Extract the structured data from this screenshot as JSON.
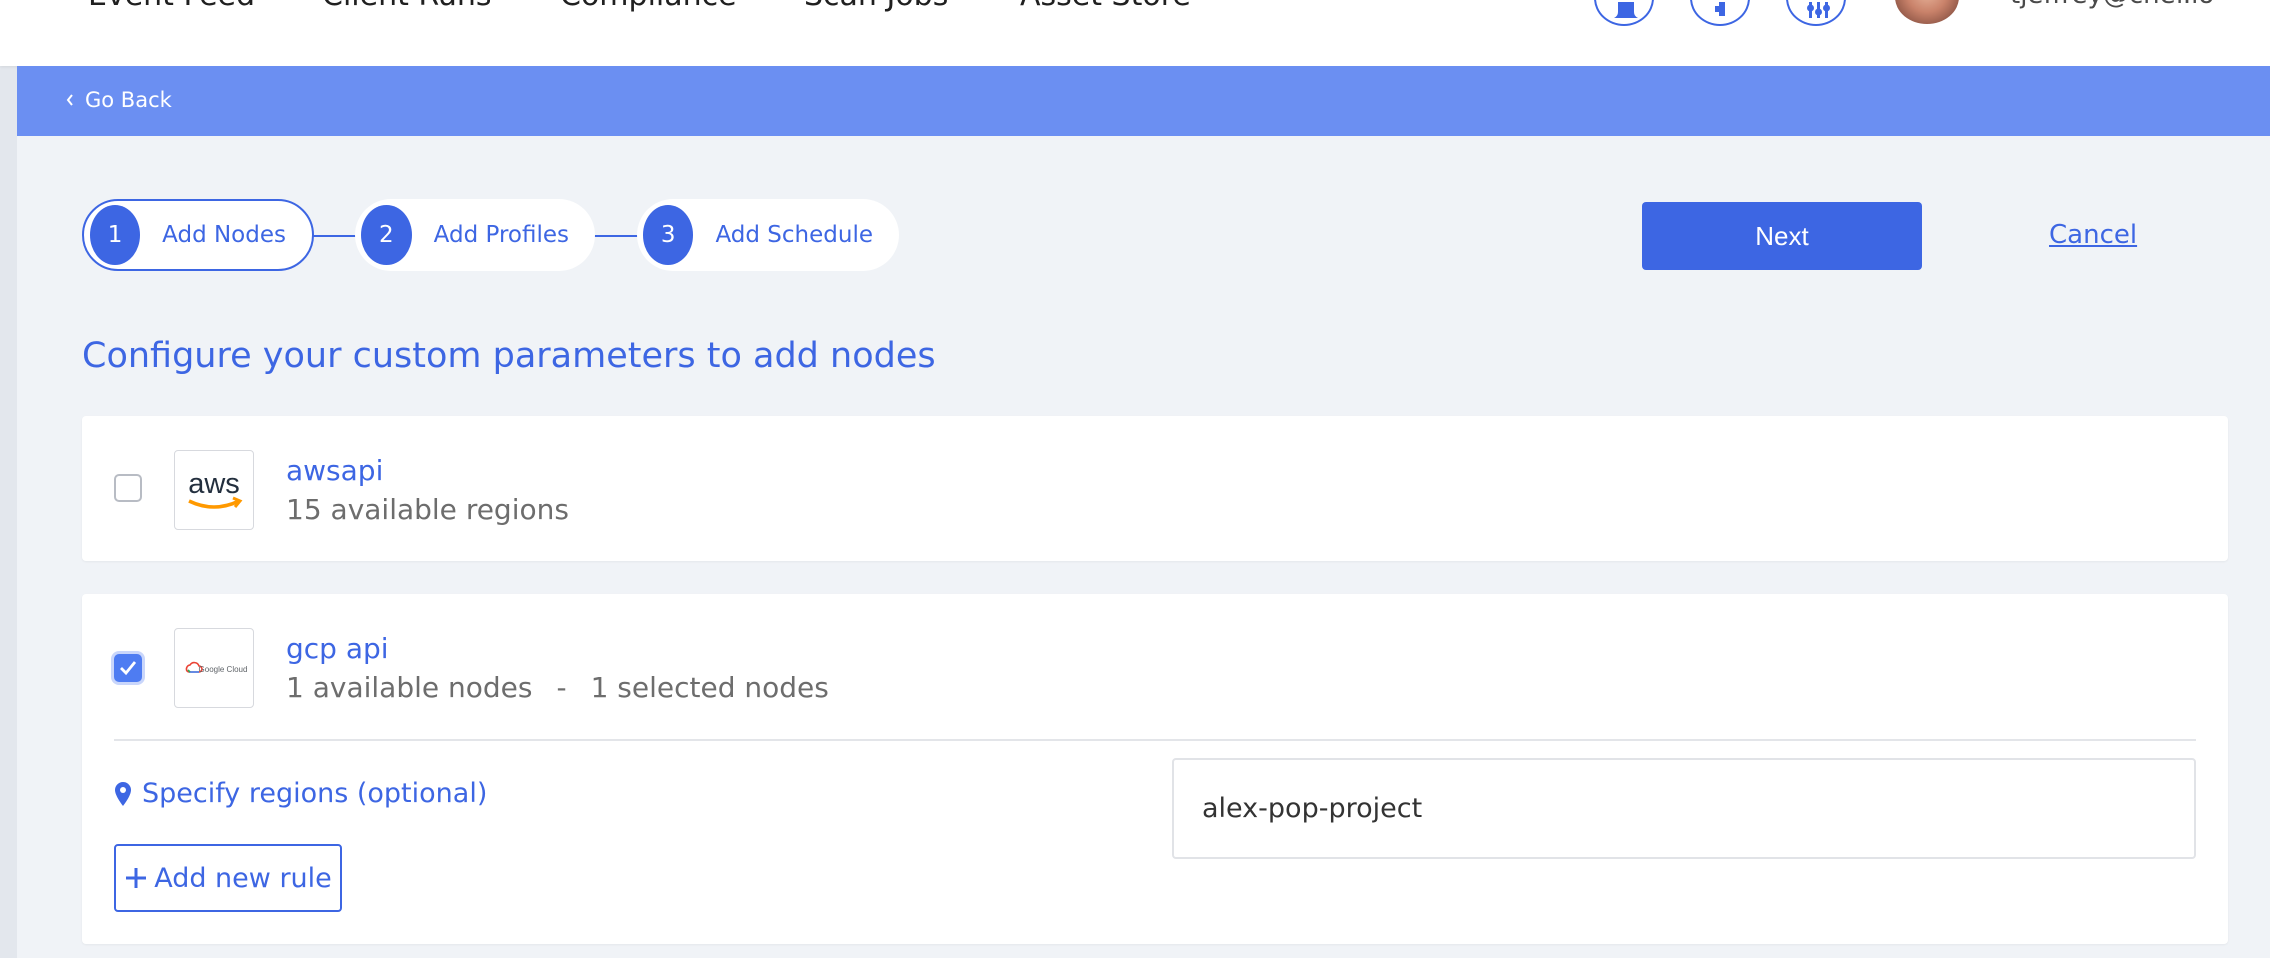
{
  "nav": {
    "items": [
      "Event Feed",
      "Client Runs",
      "Compliance",
      "Scan Jobs",
      "Asset Store"
    ],
    "user_email": "tjeffrey@chef.io"
  },
  "banner": {
    "go_back": "Go Back"
  },
  "stepper": {
    "steps": [
      {
        "num": "1",
        "label": "Add Nodes"
      },
      {
        "num": "2",
        "label": "Add Profiles"
      },
      {
        "num": "3",
        "label": "Add Schedule"
      }
    ]
  },
  "actions": {
    "next": "Next",
    "cancel": "Cancel"
  },
  "heading": "Configure your custom parameters to add nodes",
  "managers": [
    {
      "name": "awsapi",
      "subtitle": "15 available regions",
      "checked": false,
      "logo_text": "aws"
    },
    {
      "name": "gcp api",
      "available": "1 available nodes",
      "separator": "-",
      "selected": "1 selected nodes",
      "checked": true,
      "logo_text": "Google Cloud"
    }
  ],
  "gcp_config": {
    "specify_regions": "Specify regions (optional)",
    "add_rule": "Add new rule",
    "region_value": "alex-pop-project"
  },
  "colors": {
    "accent": "#3d66e3",
    "banner": "#6b8ff2",
    "background": "#f0f3f7"
  }
}
